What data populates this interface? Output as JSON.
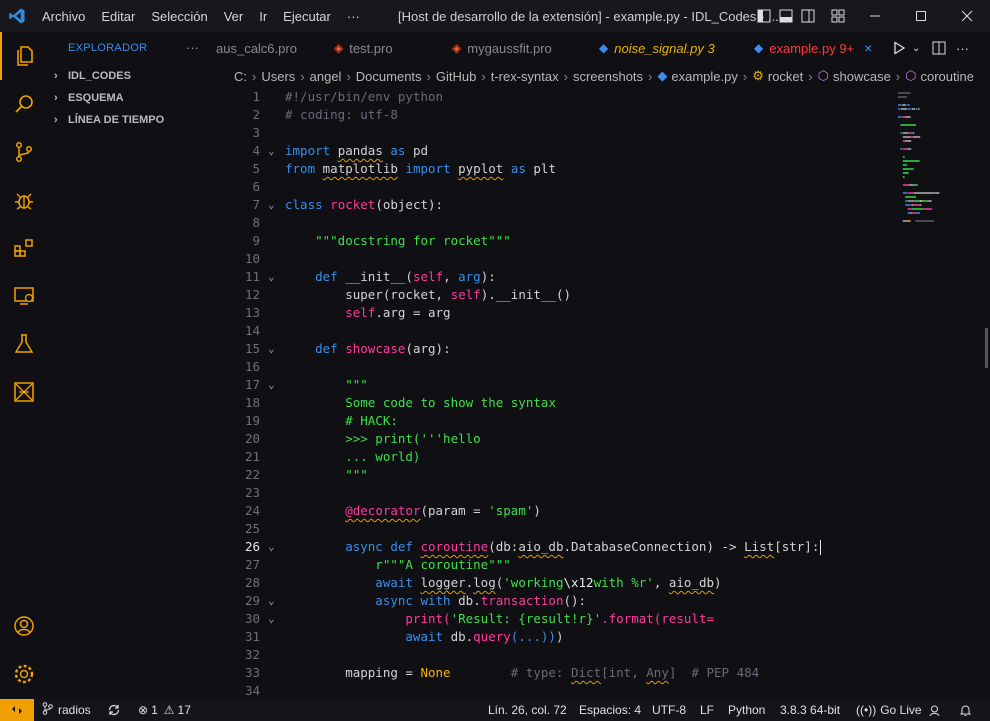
{
  "menu": [
    "Archivo",
    "Editar",
    "Selección",
    "Ver",
    "Ir",
    "Ejecutar",
    "···"
  ],
  "window_title": "[Host de desarrollo de la extensión] - example.py - IDL_Codes - ...",
  "sidebar": {
    "header": "EXPLORADOR",
    "more": "···",
    "sections": [
      "IDL_CODES",
      "ESQUEMA",
      "LÍNEA DE TIEMPO"
    ]
  },
  "tabs": [
    {
      "label": "aus_calc6.pro",
      "color": "#8a8a8a",
      "italic": false
    },
    {
      "label": "test.pro",
      "color": "#8a8a8a",
      "italic": false
    },
    {
      "label": "mygaussfit.pro",
      "color": "#8a8a8a",
      "italic": false
    },
    {
      "label": "noise_signal.py 3",
      "color": "#e5b400",
      "italic": true
    },
    {
      "label": "example.py 9+",
      "color": "#ff3a3a",
      "italic": false
    }
  ],
  "breadcrumb": [
    "C:",
    "Users",
    "angel",
    "Documents",
    "GitHub",
    "t-rex-syntax",
    "screenshots",
    "example.py",
    "rocket",
    "showcase",
    "coroutine"
  ],
  "line_numbers": [
    "1",
    "2",
    "3",
    "4",
    "5",
    "6",
    "7",
    "8",
    "9",
    "10",
    "11",
    "12",
    "13",
    "14",
    "15",
    "16",
    "17",
    "18",
    "19",
    "20",
    "21",
    "22",
    "23",
    "24",
    "25",
    "26",
    "27",
    "28",
    "29",
    "30",
    "31",
    "32",
    "33",
    "34"
  ],
  "code": [
    [
      [
        "#!/usr/bin/env python",
        "cm"
      ]
    ],
    [
      [
        "# coding: utf-8",
        "cm"
      ]
    ],
    [],
    [
      [
        "import",
        "kw"
      ],
      [
        " ",
        "pl"
      ],
      [
        "pandas",
        "pl",
        "sq"
      ],
      [
        " ",
        "pl"
      ],
      [
        "as",
        "kw"
      ],
      [
        " pd",
        "pl"
      ]
    ],
    [
      [
        "from",
        "kw"
      ],
      [
        " ",
        "pl"
      ],
      [
        "matplotlib",
        "pl",
        "sq"
      ],
      [
        " ",
        "pl"
      ],
      [
        "import",
        "kw"
      ],
      [
        " ",
        "pl"
      ],
      [
        "pyplot",
        "pl",
        "sq"
      ],
      [
        " ",
        "pl"
      ],
      [
        "as",
        "kw"
      ],
      [
        " plt",
        "pl"
      ]
    ],
    [],
    [
      [
        "class",
        "kw"
      ],
      [
        " ",
        "pl"
      ],
      [
        "rocket",
        "fn"
      ],
      [
        "(object):",
        "pl"
      ]
    ],
    [],
    [
      [
        "    ",
        "pl"
      ],
      [
        "\"\"\"docstring for rocket\"\"\"",
        "st"
      ]
    ],
    [],
    [
      [
        "    ",
        "pl"
      ],
      [
        "def",
        "kw"
      ],
      [
        " __init__(",
        "pl"
      ],
      [
        "self",
        "sf"
      ],
      [
        ", ",
        "pl"
      ],
      [
        "arg",
        "kw"
      ],
      [
        "):",
        "pl"
      ]
    ],
    [
      [
        "        super(rocket, ",
        "pl"
      ],
      [
        "self",
        "sf"
      ],
      [
        ").__init__()",
        "pl"
      ]
    ],
    [
      [
        "        ",
        "pl"
      ],
      [
        "self",
        "sf"
      ],
      [
        ".arg = arg",
        "pl"
      ]
    ],
    [],
    [
      [
        "    ",
        "pl"
      ],
      [
        "def",
        "kw"
      ],
      [
        " ",
        "pl"
      ],
      [
        "showcase",
        "fn"
      ],
      [
        "(arg):",
        "pl"
      ]
    ],
    [],
    [
      [
        "        ",
        "pl"
      ],
      [
        "\"\"\"",
        "st"
      ]
    ],
    [
      [
        "        Some code to show the syntax",
        "st"
      ]
    ],
    [
      [
        "        # HACK:",
        "st"
      ]
    ],
    [
      [
        "        >>> print('''hello",
        "st"
      ]
    ],
    [
      [
        "        ... world)",
        "st"
      ]
    ],
    [
      [
        "        \"\"\"",
        "st"
      ]
    ],
    [],
    [
      [
        "        ",
        "pl"
      ],
      [
        "@decorator",
        "fn",
        "sq"
      ],
      [
        "(param = ",
        "pl"
      ],
      [
        "'spam'",
        "st"
      ],
      [
        ")",
        "pl"
      ]
    ],
    [],
    [
      [
        "        async ",
        "kw"
      ],
      [
        "def",
        "kw"
      ],
      [
        " ",
        "pl"
      ],
      [
        "coroutine",
        "fn",
        "sq"
      ],
      [
        "(db:",
        "pl"
      ],
      [
        "aio_db",
        "pl",
        "sq"
      ],
      [
        ".DatabaseConnection) -> ",
        "pl"
      ],
      [
        "List",
        "pl",
        "sq"
      ],
      [
        "[str]:",
        "pl"
      ]
    ],
    [
      [
        "            r\"\"\"A coroutine\"\"\"",
        "st"
      ]
    ],
    [
      [
        "            await ",
        "kw"
      ],
      [
        "logger",
        "pl",
        "sq"
      ],
      [
        ".",
        "pl"
      ],
      [
        "log",
        "pl",
        "sq"
      ],
      [
        "(",
        "pl"
      ],
      [
        "'working",
        "st"
      ],
      [
        "\\x12",
        "bi"
      ],
      [
        "with %r'",
        "st"
      ],
      [
        ", ",
        "pl"
      ],
      [
        "aio_db",
        "pl",
        "sq"
      ],
      [
        ")",
        "pl"
      ]
    ],
    [
      [
        "            async ",
        "kw"
      ],
      [
        "with",
        "kw"
      ],
      [
        " db.",
        "pl"
      ],
      [
        "transaction",
        "fn"
      ],
      [
        "():",
        "pl"
      ]
    ],
    [
      [
        "                print(",
        "fn"
      ],
      [
        "'Result: {result!r}'",
        "st"
      ],
      [
        ".format(",
        "fn"
      ],
      [
        "result=",
        "fn"
      ]
    ],
    [
      [
        "                await ",
        "kw"
      ],
      [
        "db.",
        "pl"
      ],
      [
        "query",
        "fn"
      ],
      [
        "(...))",
        "kw"
      ],
      [
        ")",
        "pl"
      ]
    ],
    [],
    [
      [
        "        mapping = ",
        "pl"
      ],
      [
        "None",
        "nm"
      ],
      [
        "        # type: ",
        "cm"
      ],
      [
        "Dict",
        "cm",
        "sq"
      ],
      [
        "[int, ",
        "cm"
      ],
      [
        "Any",
        "cm",
        "sq"
      ],
      [
        "]  # PEP 484",
        "cm"
      ]
    ],
    []
  ],
  "current_line": "26",
  "status": {
    "branch": "radios",
    "errors": "1",
    "warnings": "17",
    "position": "Lín. 26, col. 72",
    "spaces": "Espacios: 4",
    "encoding": "UTF-8",
    "eol": "LF",
    "language": "Python",
    "interpreter": "3.8.3 64-bit",
    "golive": "Go Live"
  },
  "colors": {
    "accent": "#f0a000",
    "keyword": "#3b8eea",
    "function": "#ff3aa0",
    "string": "#3ee04a"
  }
}
